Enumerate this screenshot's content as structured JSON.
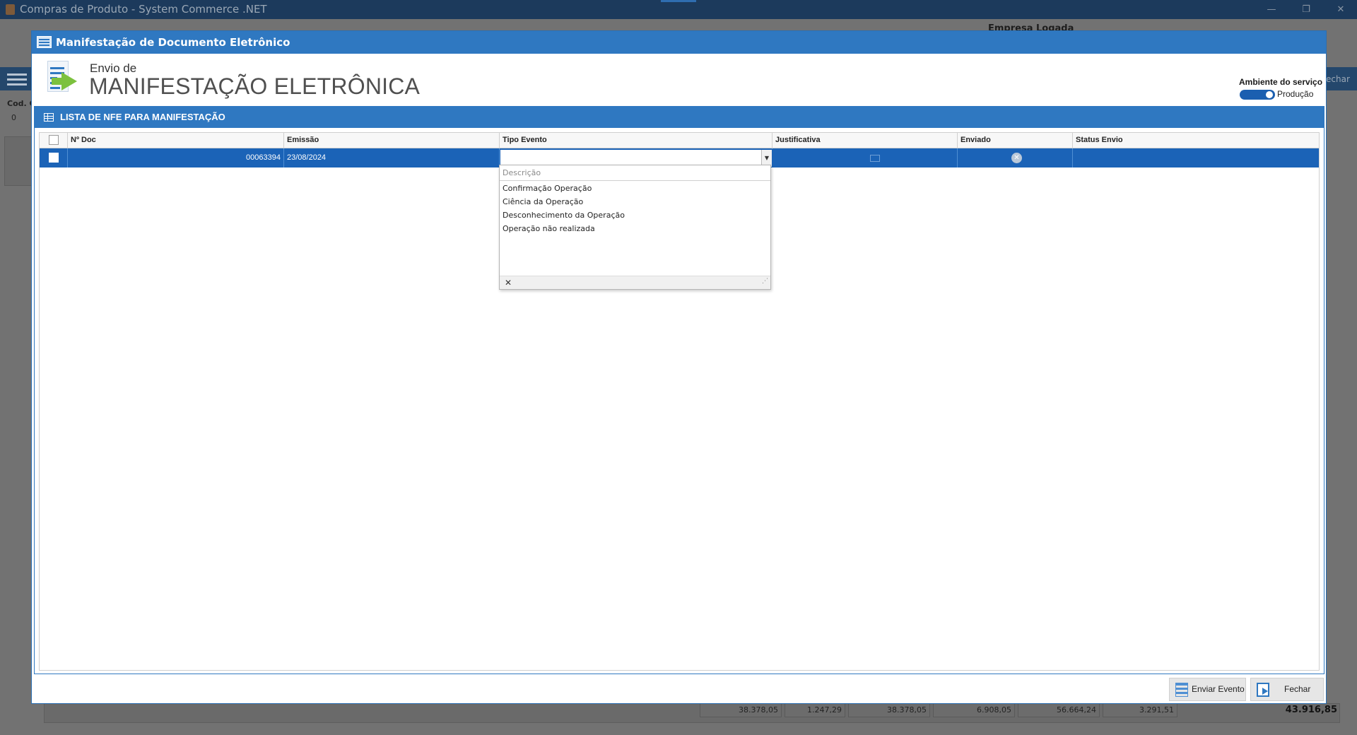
{
  "app": {
    "window_title": "Compras de Produto  -  System Commerce .NET",
    "empresa_label": "Empresa Logada",
    "cod_label": "Cod. C",
    "cod_value": "0",
    "fechar_label": "echar",
    "totals": [
      "38.378,05",
      "1.247,29",
      "38.378,05",
      "6.908,05",
      "56.664,24",
      "3.291,51"
    ],
    "grand_total": "43.916,85"
  },
  "modal": {
    "title": "Manifestação de Documento Eletrônico",
    "header_subtitle": "Envio de",
    "header_title": "MANIFESTAÇÃO ELETRÔNICA",
    "environment_label": "Ambiente do serviço",
    "environment_value": "Produção",
    "panel_title": "LISTA DE NFE PARA MANIFESTAÇÃO"
  },
  "grid": {
    "columns": [
      "Nº Doc",
      "Emissão",
      "Tipo Evento",
      "Justificativa",
      "Enviado",
      "Status Envio"
    ],
    "rows": [
      {
        "doc": "00063394",
        "emissao": "23/08/2024",
        "tipo_evento": "",
        "status_envio": ""
      }
    ]
  },
  "dropdown": {
    "header": "Descrição",
    "options": [
      "Confirmação Operação",
      "Ciência da Operação",
      "Desconhecimento da Operação",
      "Operação não realizada"
    ]
  },
  "buttons": {
    "send": "Enviar Evento",
    "close": "Fechar"
  },
  "colors": {
    "accent": "#2f78c1",
    "selection": "#1b63b7",
    "brand_green": "#7cc13e"
  }
}
